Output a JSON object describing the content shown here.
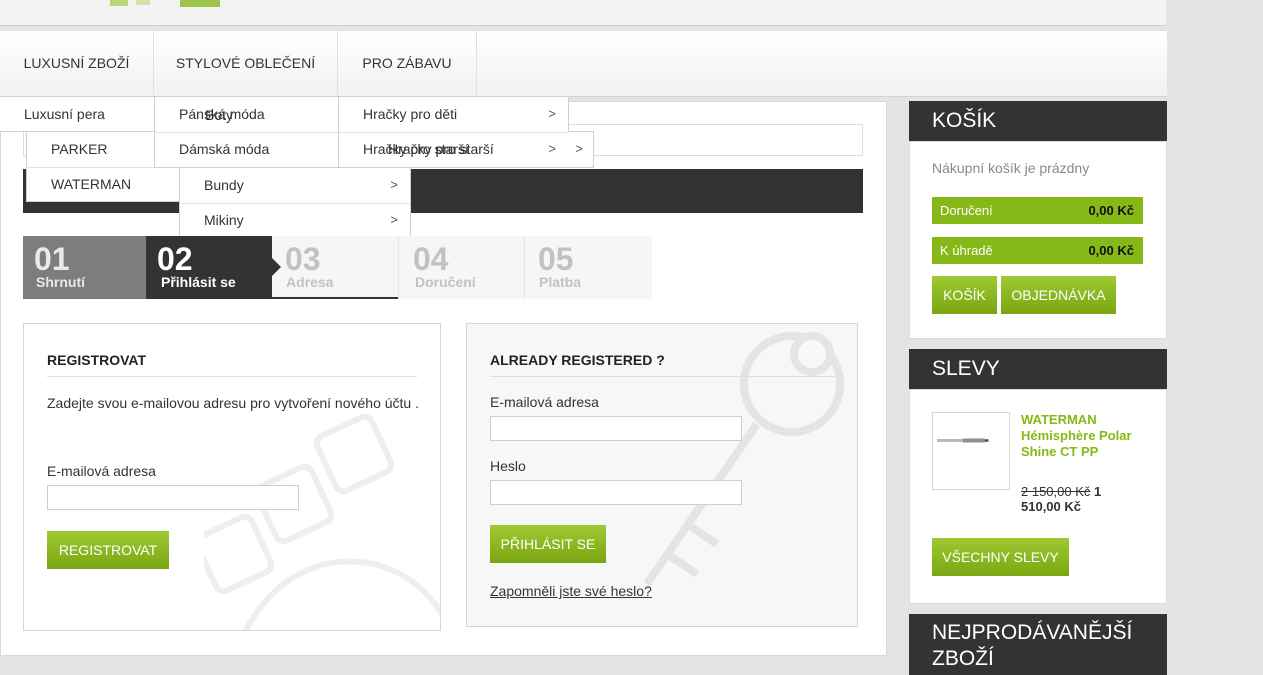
{
  "nav": {
    "items": [
      "LUXUSNÍ ZBOŽÍ",
      "STYLOVÉ OBLEČENÍ",
      "PRO ZÁBAVU"
    ]
  },
  "dropdowns": {
    "luxury": {
      "item": "Luxusní pera",
      "sub": [
        "PARKER",
        "WATERMAN"
      ]
    },
    "fashion": {
      "items": [
        "Pánská móda",
        "Dámská móda"
      ],
      "overlap_text": "Boty",
      "sub": [
        "Bundy",
        "Mikiny"
      ]
    },
    "fun": {
      "items": [
        "Hračky pro děti",
        "Hračky pro starší"
      ],
      "overlap_text": "Hračky pro starší"
    }
  },
  "steps": [
    {
      "num": "01",
      "label": "Shrnutí"
    },
    {
      "num": "02",
      "label": "Přihlásit se"
    },
    {
      "num": "03",
      "label": "Adresa"
    },
    {
      "num": "04",
      "label": "Doručení"
    },
    {
      "num": "05",
      "label": "Platba"
    }
  ],
  "register": {
    "title": "REGISTROVAT",
    "intro": "Zadejte svou e-mailovou adresu pro vytvoření nového účtu .",
    "email_label": "E-mailová adresa",
    "button": "REGISTROVAT"
  },
  "login": {
    "title": "ALREADY REGISTERED ?",
    "email_label": "E-mailová adresa",
    "password_label": "Heslo",
    "button": "PŘIHLÁSIT SE",
    "forgot": "Zapomněli jste své heslo?"
  },
  "cart": {
    "title": "KOŠÍK",
    "empty": "Nákupní košík je prázdny",
    "rows": [
      {
        "label": "Doručení",
        "value": "0,00 Kč"
      },
      {
        "label": "K úhradě",
        "value": "0,00 Kč"
      }
    ],
    "cart_button": "KOŠÍK",
    "order_button": "OBJEDNÁVKA"
  },
  "discounts": {
    "title": "SLEVY",
    "product_name": "WATERMAN Hémisphère Polar Shine CT PP",
    "old_price": "2 150,00 Kč",
    "new_price": "1 510,00 Kč",
    "all_button": "VŠECHNY SLEVY"
  },
  "bestsellers": {
    "title": "NEJPRODÁVANĚJŠÍ ZBOŽÍ"
  },
  "colors": {
    "accent_green": "#86b817",
    "dark": "#333333"
  }
}
